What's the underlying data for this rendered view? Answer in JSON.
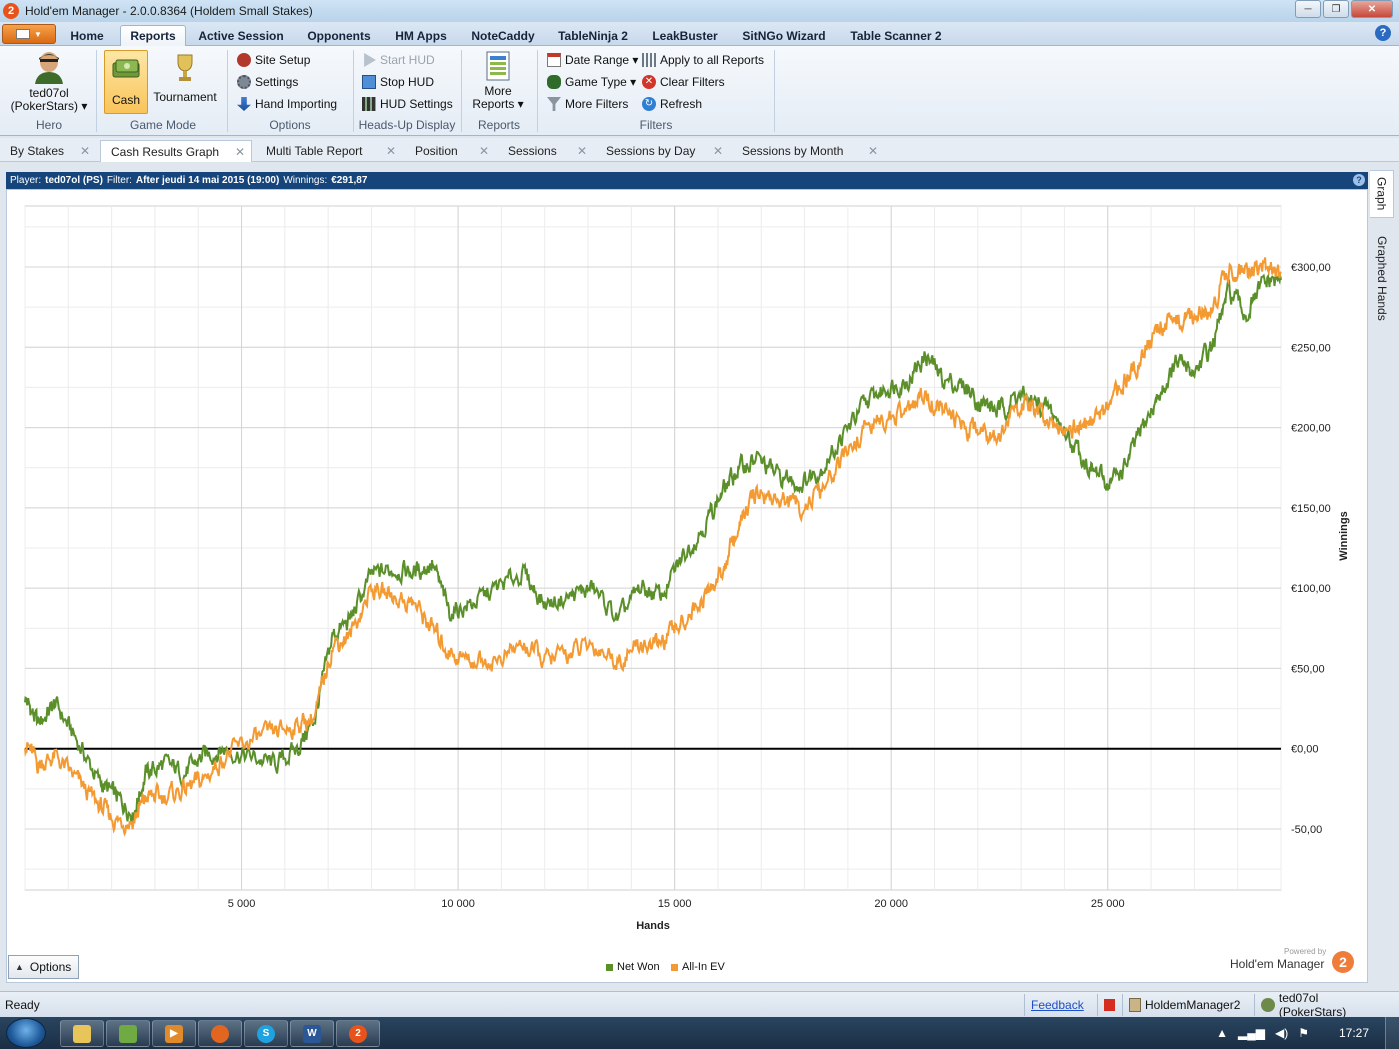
{
  "window": {
    "title": "Hold'em Manager - 2.0.0.8364 (Holdem Small Stakes)",
    "controls": {
      "minimize": "─",
      "maximize": "❐",
      "close": "✕"
    }
  },
  "ribbon_tabs": [
    "Home",
    "Reports",
    "Active Session",
    "Opponents",
    "HM Apps",
    "NoteCaddy",
    "TableNinja 2",
    "LeakBuster",
    "SitNGo Wizard",
    "Table Scanner 2"
  ],
  "active_ribbon_tab": "Reports",
  "ribbon": {
    "hero": {
      "name": "ted07ol",
      "site": "(PokerStars) ▾",
      "group": "Hero"
    },
    "game_mode": {
      "cash": "Cash",
      "tournament": "Tournament",
      "group": "Game Mode"
    },
    "options": {
      "site_setup": "Site Setup",
      "settings": "Settings",
      "hand_importing": "Hand Importing",
      "group": "Options"
    },
    "hud": {
      "start": "Start HUD",
      "stop": "Stop HUD",
      "settings": "HUD Settings",
      "group": "Heads-Up Display"
    },
    "reports": {
      "more_line1": "More",
      "more_line2": "Reports ▾",
      "group": "Reports"
    },
    "filters": {
      "date_range": "Date Range ▾",
      "game_type": "Game Type ▾",
      "more_filters": "More Filters",
      "apply_all": "Apply to all Reports",
      "clear": "Clear Filters",
      "refresh": "Refresh",
      "group": "Filters"
    }
  },
  "report_tabs": [
    "By Stakes",
    "Cash Results Graph",
    "Multi Table Report",
    "Position",
    "Sessions",
    "Sessions by Day",
    "Sessions by Month"
  ],
  "active_report_tab": "Cash Results Graph",
  "info_bar": {
    "player_label": "Player:",
    "player": "ted07ol (PS)",
    "filter_label": "Filter:",
    "filter": "After jeudi 14 mai 2015 (19:00)",
    "winnings_label": "Winnings:",
    "winnings": "€291,87"
  },
  "side_tabs": [
    "Graph",
    "Graphed Hands"
  ],
  "options_button": "Options",
  "powered_by": {
    "small": "Powered by",
    "big": "Hold'em Manager",
    "logo": "2"
  },
  "status": {
    "ready": "Ready",
    "feedback": "Feedback",
    "app": "HoldemManager2",
    "player": "ted07ol (PokerStars)"
  },
  "taskbar": {
    "time": "17:27"
  },
  "colors": {
    "net_won": "#5b8f2a",
    "all_in_ev": "#f39a33",
    "accent": "#16457c"
  },
  "chart_data": {
    "type": "line",
    "xlabel": "Hands",
    "ylabel": "Winnings",
    "xlim": [
      0,
      29000
    ],
    "ylim": [
      -88,
      338
    ],
    "x_ticks": [
      5000,
      10000,
      15000,
      20000,
      25000
    ],
    "x_tick_labels": [
      "5 000",
      "10 000",
      "15 000",
      "20 000",
      "25 000"
    ],
    "y_ticks": [
      -50,
      0,
      50,
      100,
      150,
      200,
      250,
      300
    ],
    "y_tick_labels": [
      "-50,00",
      "€0,00",
      "€50,00",
      "€100,00",
      "€150,00",
      "€200,00",
      "€250,00",
      "€300,00"
    ],
    "y_tick_prefix": "€",
    "grid": true,
    "legend_position": "bottom-center",
    "series": [
      {
        "name": "Net Won",
        "color": "#5b8f2a",
        "x": [
          0,
          300,
          700,
          1200,
          1700,
          2100,
          2500,
          2800,
          3200,
          3700,
          4100,
          4600,
          5200,
          5800,
          6300,
          6700,
          7100,
          7500,
          8000,
          8500,
          9000,
          9400,
          9800,
          10300,
          10900,
          11500,
          12000,
          12600,
          13100,
          13700,
          14200,
          14700,
          15200,
          15700,
          16100,
          16500,
          16900,
          17400,
          17900,
          18400,
          18900,
          19400,
          19900,
          20400,
          20800,
          21200,
          21700,
          22100,
          22500,
          22900,
          23300,
          23700,
          24200,
          24600,
          25000,
          25400,
          25800,
          26200,
          26600,
          27000,
          27400,
          27800,
          28200,
          28600,
          29000
        ],
        "y": [
          32,
          15,
          28,
          5,
          -20,
          -30,
          -40,
          -15,
          -10,
          -15,
          -5,
          0,
          -5,
          -10,
          0,
          20,
          70,
          80,
          108,
          112,
          110,
          115,
          85,
          90,
          100,
          110,
          90,
          95,
          100,
          80,
          100,
          95,
          120,
          140,
          160,
          175,
          180,
          170,
          165,
          175,
          195,
          215,
          225,
          230,
          245,
          230,
          225,
          215,
          210,
          220,
          215,
          210,
          190,
          175,
          165,
          175,
          200,
          220,
          240,
          235,
          250,
          285,
          270,
          290,
          292
        ]
      },
      {
        "name": "All-In EV",
        "color": "#f39a33",
        "x": [
          0,
          300,
          700,
          1200,
          1700,
          2100,
          2500,
          2800,
          3200,
          3700,
          4100,
          4600,
          5200,
          5800,
          6300,
          6700,
          7100,
          7500,
          8000,
          8500,
          9000,
          9400,
          9800,
          10300,
          10900,
          11500,
          12000,
          12600,
          13100,
          13700,
          14200,
          14700,
          15200,
          15700,
          16100,
          16500,
          16900,
          17400,
          17900,
          18400,
          18900,
          19400,
          19900,
          20400,
          20800,
          21200,
          21700,
          22100,
          22500,
          22900,
          23300,
          23700,
          24200,
          24600,
          25000,
          25400,
          25800,
          26200,
          26600,
          27000,
          27400,
          27800,
          28200,
          28600,
          29000
        ],
        "y": [
          5,
          -10,
          -5,
          -20,
          -35,
          -45,
          -45,
          -30,
          -30,
          -25,
          -20,
          -5,
          5,
          10,
          15,
          20,
          65,
          70,
          100,
          95,
          90,
          75,
          60,
          55,
          55,
          65,
          55,
          60,
          65,
          55,
          65,
          65,
          80,
          95,
          110,
          140,
          160,
          155,
          150,
          160,
          180,
          200,
          205,
          210,
          220,
          210,
          200,
          200,
          195,
          215,
          210,
          205,
          200,
          205,
          210,
          230,
          245,
          265,
          265,
          270,
          275,
          300,
          295,
          300,
          297
        ]
      }
    ]
  }
}
